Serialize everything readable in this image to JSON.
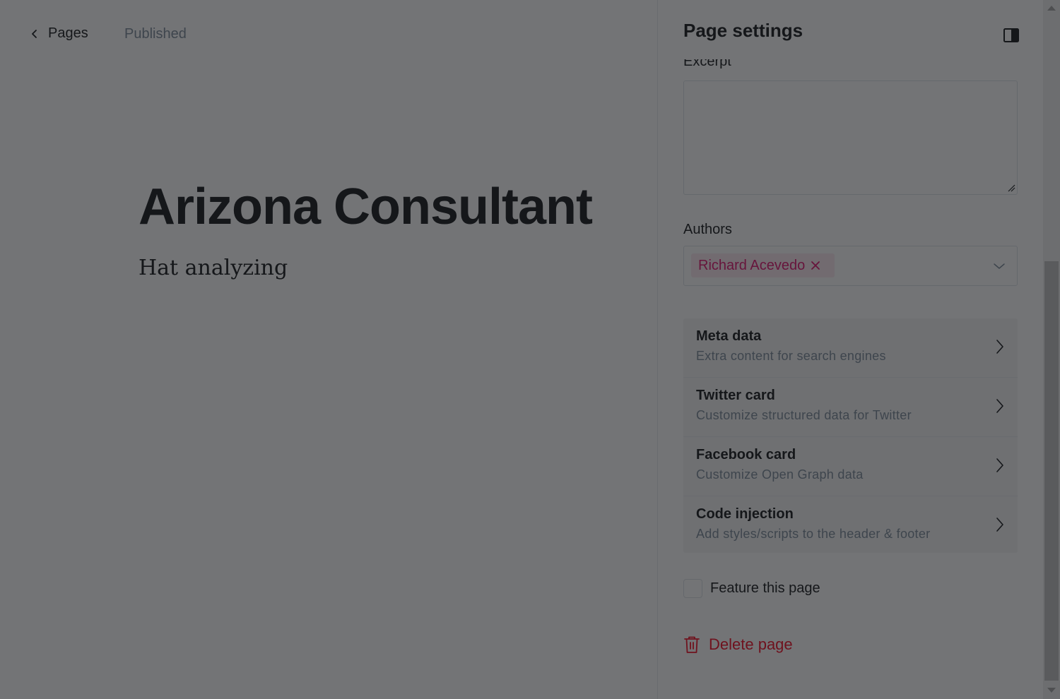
{
  "editor": {
    "back_label": "Pages",
    "status": "Published",
    "title": "Arizona Consultant",
    "excerpt": "Hat analyzing"
  },
  "settings": {
    "title": "Page settings",
    "excerpt_label": "Excerpt",
    "excerpt_value": "",
    "authors_label": "Authors",
    "authors": [
      {
        "name": "Richard Acevedo"
      }
    ],
    "nav_items": [
      {
        "title": "Meta data",
        "description": "Extra content for search engines"
      },
      {
        "title": "Twitter card",
        "description": "Customize structured data for Twitter"
      },
      {
        "title": "Facebook card",
        "description": "Customize Open Graph data"
      },
      {
        "title": "Code injection",
        "description": "Add styles/scripts to the header & footer"
      }
    ],
    "feature_label": "Feature this page",
    "feature_checked": false,
    "delete_label": "Delete page"
  },
  "colors": {
    "accent_pink": "#e0136e",
    "danger_red": "#f50b23",
    "overlay": "rgba(21,23,26,0.6)"
  },
  "icons": {
    "back": "chevron-left-icon",
    "panel_toggle": "sidebar-toggle-icon",
    "token_remove": "close-icon",
    "dropdown": "chevron-down-icon",
    "nav": "chevron-right-icon",
    "delete": "trash-icon"
  }
}
